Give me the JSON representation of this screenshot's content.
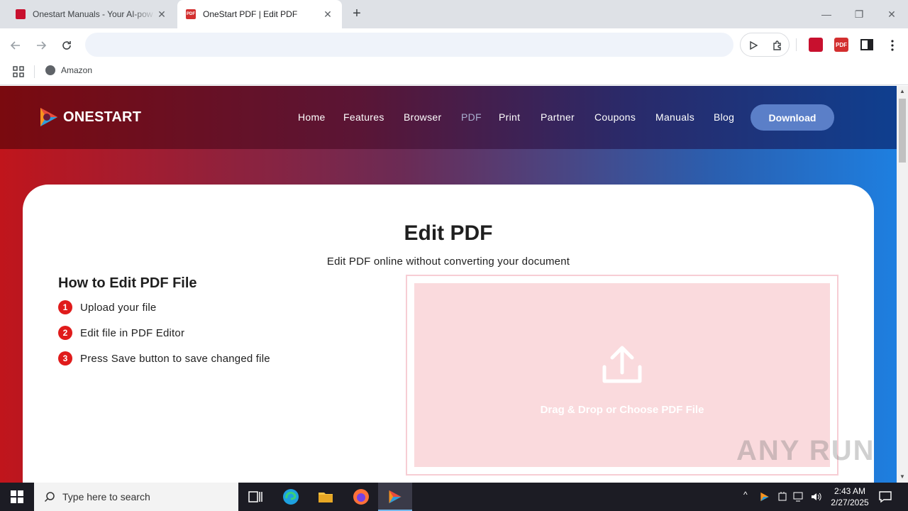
{
  "browser": {
    "tabs": [
      {
        "title": "Onestart Manuals - Your AI-pow",
        "favicon_color": "#c8102e",
        "active": false
      },
      {
        "title": "OneStart PDF | Edit PDF",
        "favicon_color": "#d32f2f",
        "favicon_text": "PDF",
        "active": true
      }
    ],
    "new_tab_glyph": "+",
    "close_glyph": "✕",
    "window_controls": {
      "minimize": "—",
      "restore": "❐",
      "close": "✕"
    },
    "omnibox": {
      "value": "",
      "placeholder": ""
    },
    "bookmarks": [
      {
        "label": "Amazon",
        "icon": "globe-icon"
      }
    ],
    "extensions": [
      {
        "icon": "onestart-manuals-icon",
        "color": "#c8102e"
      },
      {
        "icon": "pdf-icon",
        "color": "#d32f2f",
        "text": "PDF"
      }
    ]
  },
  "site": {
    "logo_text": "ONESTART",
    "nav": [
      "Home",
      "Features",
      "Browser",
      "PDF",
      "Print",
      "Partner",
      "Coupons",
      "Manuals",
      "Blog"
    ],
    "current_nav": "PDF",
    "download_label": "Download"
  },
  "content": {
    "title": "Edit PDF",
    "subtitle": "Edit PDF online without converting your document",
    "howto_title": "How to Edit PDF File",
    "steps": [
      {
        "num": "1",
        "text": "Upload your file"
      },
      {
        "num": "2",
        "text": "Edit file in PDF Editor"
      },
      {
        "num": "3",
        "text": "Press Save button to save changed file"
      }
    ],
    "dropzone_text": "Drag & Drop or Choose PDF File"
  },
  "watermark": "ANY RUN",
  "taskbar": {
    "search_placeholder": "Type here to search",
    "time": "2:43 AM",
    "date": "2/27/2025"
  },
  "colors": {
    "accent_red": "#e01b1b",
    "download_button": "#5b7fc8",
    "dropzone_fill": "#fadadd"
  }
}
